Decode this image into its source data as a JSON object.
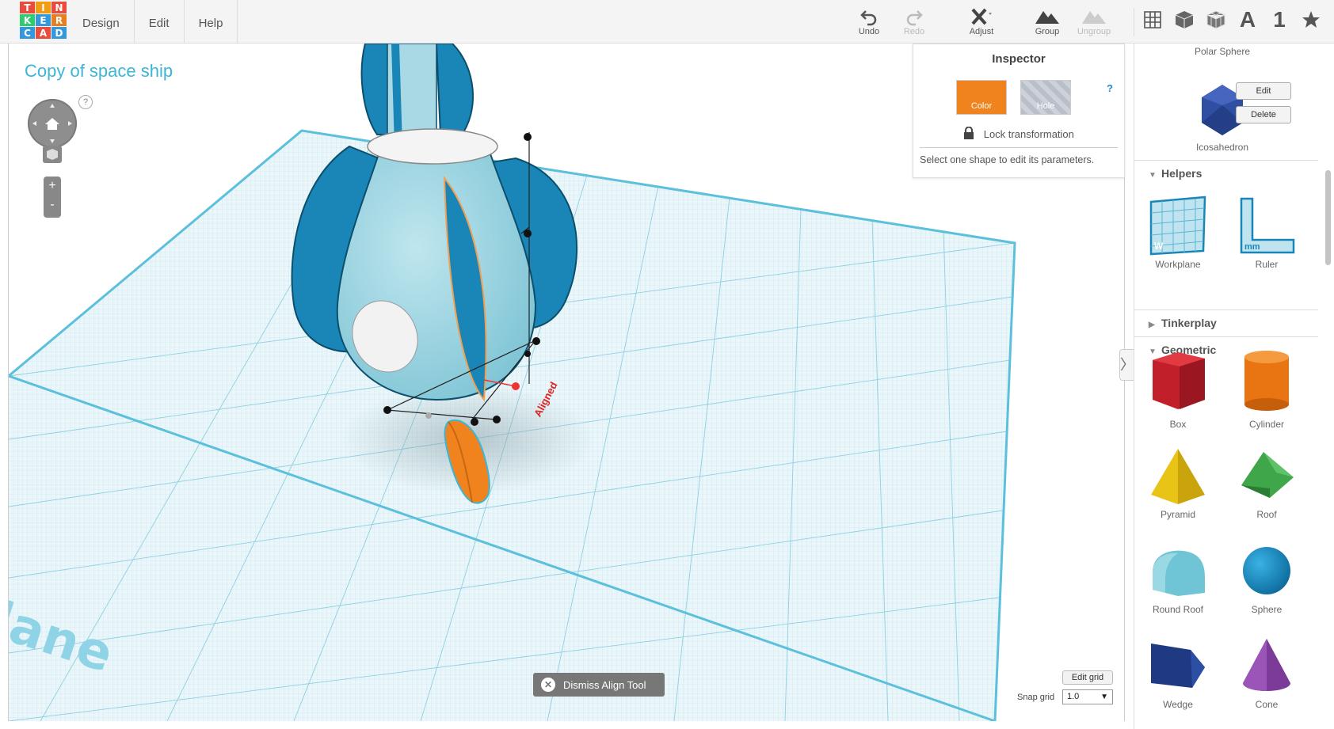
{
  "logo": {
    "letters": [
      "T",
      "I",
      "N",
      "K",
      "E",
      "R",
      "C",
      "A",
      "D",
      "",
      "",
      ""
    ]
  },
  "menu": {
    "design": "Design",
    "edit": "Edit",
    "help": "Help"
  },
  "toolbar": {
    "undo": "Undo",
    "redo": "Redo",
    "adjust": "Adjust",
    "group": "Group",
    "ungroup": "Ungroup"
  },
  "view_icons": {
    "text_icon_label": "A",
    "number_icon_label": "1"
  },
  "project": {
    "title": "Copy of space ship"
  },
  "nav": {
    "help": "?",
    "zoom_in": "+",
    "zoom_out": "-"
  },
  "scene": {
    "aligned_label": "Aligned",
    "workplane_text": "lane"
  },
  "inspector": {
    "title": "Inspector",
    "color_label": "Color",
    "hole_label": "Hole",
    "help": "?",
    "lock_label": "Lock transformation",
    "note": "Select one shape to edit its parameters."
  },
  "dismiss": {
    "label": "Dismiss Align Tool"
  },
  "grid": {
    "edit_label": "Edit grid",
    "snap_label": "Snap grid",
    "snap_value": "1.0"
  },
  "sidebar": {
    "top_shape_label": "Polar Sphere",
    "icosahedron_label": "Icosahedron",
    "edit_button": "Edit",
    "delete_button": "Delete",
    "helpers_title": "Helpers",
    "workplane_label": "Workplane",
    "ruler_label": "Ruler",
    "tinkerplay_title": "Tinkerplay",
    "geometric_title": "Geometric",
    "shapes": {
      "box": "Box",
      "cylinder": "Cylinder",
      "pyramid": "Pyramid",
      "roof": "Roof",
      "round_roof": "Round Roof",
      "sphere": "Sphere",
      "wedge": "Wedge",
      "cone": "Cone"
    }
  },
  "colors": {
    "accent": "#3bb6d7",
    "selected_orange": "#f0831e",
    "shape_blue": "#1a86b8",
    "shape_light": "#9fd5e0"
  }
}
